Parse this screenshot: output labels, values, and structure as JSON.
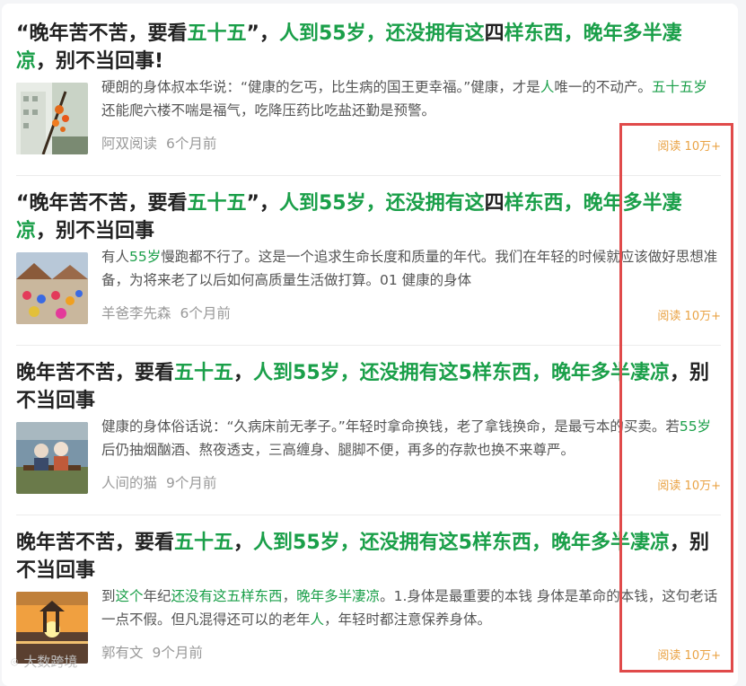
{
  "colors": {
    "highlight": "#1a9f49",
    "reads": "#e9a243",
    "annotation": "#e04a4a"
  },
  "articles": [
    {
      "title_parts": [
        {
          "t": "“晚年苦不苦，要看"
        },
        {
          "t": "五十五",
          "hl": true
        },
        {
          "t": "”，"
        },
        {
          "t": "人到55岁，还没拥有这",
          "hl": true
        },
        {
          "t": "四"
        },
        {
          "t": "样东西，晚年多半凄凉",
          "hl": true
        },
        {
          "t": "，别不当回事!"
        }
      ],
      "snippet_parts": [
        {
          "t": "硬朗的身体叔本华说：“健康的乞丐，比生病的国王更幸福。”健康，才是"
        },
        {
          "t": "人",
          "hl": true
        },
        {
          "t": "唯一的不动产。"
        },
        {
          "t": "五十五岁",
          "hl": true
        },
        {
          "t": "还能爬六楼不喘是福气，吃降压药比吃盐还勤是预警。"
        }
      ],
      "author": "阿双阅读",
      "time": "6个月前",
      "reads": "阅读 10万+",
      "thumb": "tree"
    },
    {
      "title_parts": [
        {
          "t": "“晚年苦不苦，要看"
        },
        {
          "t": "五十五",
          "hl": true
        },
        {
          "t": "”，"
        },
        {
          "t": "人到55岁，还没拥有这",
          "hl": true
        },
        {
          "t": "四"
        },
        {
          "t": "样东西，晚年多半凄凉",
          "hl": true
        },
        {
          "t": "，别不当回事"
        }
      ],
      "snippet_parts": [
        {
          "t": "有人"
        },
        {
          "t": "55岁",
          "hl": true
        },
        {
          "t": "慢跑都不行了。这是一个追求生命长度和质量的年代。我们在年轻的时候就应该做好思想准备，为将来老了以后如何高质量生活做打算。01 健康的身体"
        }
      ],
      "author": "羊爸李先森",
      "time": "6个月前",
      "reads": "阅读 10万+",
      "thumb": "dance"
    },
    {
      "title_parts": [
        {
          "t": "晚年苦不苦，要看"
        },
        {
          "t": "五十五",
          "hl": true
        },
        {
          "t": "，"
        },
        {
          "t": "人到55岁，还没拥有这5样东西，晚年多半凄凉",
          "hl": true
        },
        {
          "t": "，别不当回事"
        }
      ],
      "snippet_parts": [
        {
          "t": "健康的身体俗话说：“久病床前无孝子。”年轻时拿命换钱，老了拿钱换命，是最亏本的买卖。若"
        },
        {
          "t": "55岁",
          "hl": true
        },
        {
          "t": "后仍抽烟酗酒、熬夜透支，三高缠身、腿脚不便，再多的存款也换不来尊严。"
        }
      ],
      "author": "人间的猫",
      "time": "9个月前",
      "reads": "阅读 10万+",
      "thumb": "elders"
    },
    {
      "title_parts": [
        {
          "t": "晚年苦不苦，要看"
        },
        {
          "t": "五十五",
          "hl": true
        },
        {
          "t": "，"
        },
        {
          "t": "人到55岁，还没拥有这5样东西，晚年多半凄凉",
          "hl": true
        },
        {
          "t": "，别不当回事"
        }
      ],
      "snippet_parts": [
        {
          "t": "到"
        },
        {
          "t": "这个",
          "hl": true
        },
        {
          "t": "年纪"
        },
        {
          "t": "还没有这五样东西",
          "hl": true
        },
        {
          "t": "，"
        },
        {
          "t": "晚年多半凄凉",
          "hl": true
        },
        {
          "t": "。1.身体是最重要的本钱 身体是革命的本钱，这句老话一点不假。但凡混得还可以的老年"
        },
        {
          "t": "人",
          "hl": true
        },
        {
          "t": "，年轻时都注意保养身体。"
        }
      ],
      "author": "郭有文",
      "time": "9个月前",
      "reads": "阅读 10万+",
      "thumb": "sunset"
    }
  ],
  "watermark": {
    "icon": "camera-icon",
    "text": "大数跨境"
  }
}
